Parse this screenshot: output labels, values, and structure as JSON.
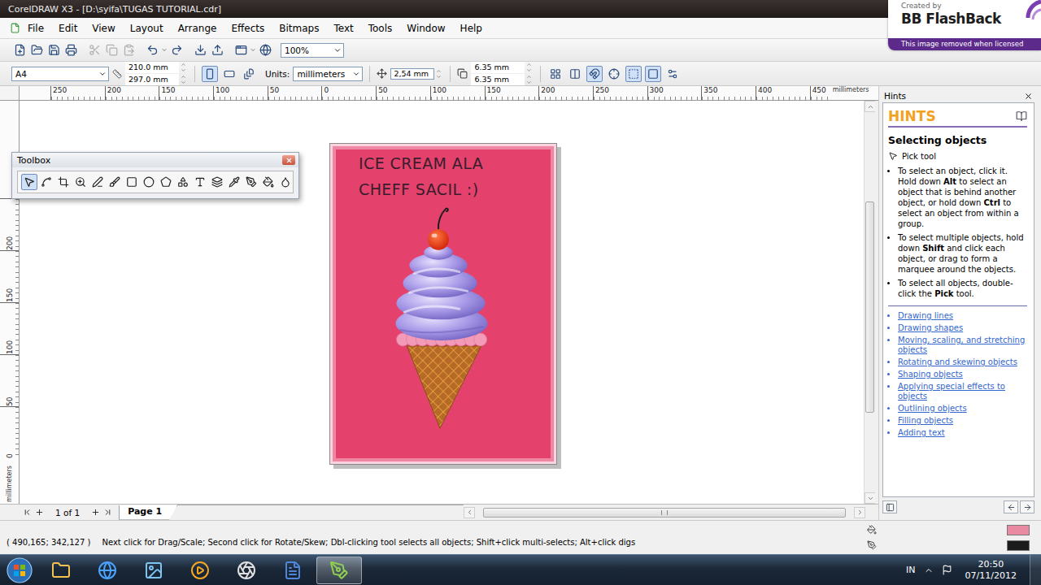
{
  "window": {
    "title": "CorelDRAW X3 - [D:\\syifa\\TUGAS TUTORIAL.cdr]"
  },
  "watermark": {
    "caption": "Created by",
    "brand": "BB FlashBack",
    "notice": "This image removed when licensed"
  },
  "menu": [
    "File",
    "Edit",
    "View",
    "Layout",
    "Arrange",
    "Effects",
    "Bitmaps",
    "Text",
    "Tools",
    "Window",
    "Help"
  ],
  "standard_toolbar": {
    "buttons": [
      {
        "disabled": false
      },
      {
        "disabled": false
      },
      {
        "disabled": false
      },
      {
        "disabled": false
      },
      {
        "disabled": true
      },
      {
        "disabled": true
      },
      {
        "disabled": true
      },
      {
        "disabled": false
      },
      {
        "disabled": false
      },
      {
        "disabled": false
      },
      {
        "disabled": false
      },
      {
        "disabled": false
      },
      {
        "disabled": false
      }
    ],
    "zoom": "100%"
  },
  "property_bar": {
    "paper": "A4",
    "width": "210.0 mm",
    "height": "297.0 mm",
    "orientation": [
      {
        "selected": true
      },
      {
        "selected": false
      }
    ],
    "units_label": "Units:",
    "units": "millimeters",
    "nudge": "2,54 mm",
    "duplicate_x": "6.35 mm",
    "duplicate_y": "6.35 mm",
    "buttons": [
      {
        "selected": false
      },
      {
        "selected": false
      },
      {
        "selected": true
      },
      {
        "selected": false
      },
      {
        "selected": true
      },
      {
        "selected": true
      },
      {
        "selected": false
      }
    ]
  },
  "rulers": {
    "horizontal": [
      "250",
      "200",
      "150",
      "100",
      "50",
      "0",
      "50",
      "100",
      "150",
      "200",
      "250",
      "300",
      "350",
      "400",
      "450"
    ],
    "vertical": [
      "200",
      "150",
      "100",
      "50",
      "0"
    ],
    "unit": "millimeters"
  },
  "toolbox": {
    "title": "Toolbox",
    "tools": [
      {
        "selected": true
      },
      {
        "selected": false
      },
      {
        "selected": false
      },
      {
        "selected": false
      },
      {
        "selected": false
      },
      {
        "selected": false
      },
      {
        "selected": false
      },
      {
        "selected": false
      },
      {
        "selected": false
      },
      {
        "selected": false
      },
      {
        "selected": false
      },
      {
        "selected": false
      },
      {
        "selected": false
      },
      {
        "selected": false
      },
      {
        "selected": false
      },
      {
        "selected": false
      }
    ]
  },
  "artwork": {
    "title_lines": [
      "ICE CREAM ALA",
      "CHEFF SACIL :)"
    ]
  },
  "hints": {
    "panel_title": "Hints",
    "heading": "HINTS",
    "topic": "Selecting objects",
    "tool": "Pick tool",
    "bullets": [
      [
        {
          "text": "To select an object, click it. Hold down ",
          "bold": false
        },
        {
          "text": "Alt",
          "bold": true
        },
        {
          "text": " to select an object that is behind another object, or hold down ",
          "bold": false
        },
        {
          "text": "Ctrl",
          "bold": true
        },
        {
          "text": " to select an object from within a group.",
          "bold": false
        }
      ],
      [
        {
          "text": "To select multiple objects, hold down ",
          "bold": false
        },
        {
          "text": "Shift",
          "bold": true
        },
        {
          "text": " and click each object, or drag to form a marquee around the objects.",
          "bold": false
        }
      ],
      [
        {
          "text": "To select all objects, double-click the ",
          "bold": false
        },
        {
          "text": "Pick",
          "bold": true
        },
        {
          "text": " tool.",
          "bold": false
        }
      ]
    ],
    "links": [
      "Drawing lines",
      "Drawing shapes",
      "Moving, scaling, and stretching objects",
      "Rotating and skewing objects",
      "Shaping objects",
      "Applying special effects to objects",
      "Outlining objects",
      "Filling objects",
      "Adding text"
    ]
  },
  "page_tabs": {
    "counter": "1 of 1",
    "tabs": [
      {
        "label": "Page 1",
        "selected": true
      }
    ]
  },
  "status_bar": {
    "coords": "( 490,165; 342,127 )",
    "message": "Next click for Drag/Scale; Second click for Rotate/Skew; Dbl-clicking tool selects all objects; Shift+click multi-selects; Alt+click digs",
    "swatches": [
      {
        "name": "fill",
        "color": "#ea8aa2"
      },
      {
        "name": "outline",
        "color": "#1b1b1b"
      }
    ]
  },
  "taskbar": {
    "apps": [
      {
        "selected": false
      },
      {
        "selected": false
      },
      {
        "selected": false
      },
      {
        "selected": false
      },
      {
        "selected": false
      },
      {
        "selected": false
      },
      {
        "selected": true
      }
    ],
    "language": "IN",
    "time": "20:50",
    "date": "07/11/2012"
  }
}
